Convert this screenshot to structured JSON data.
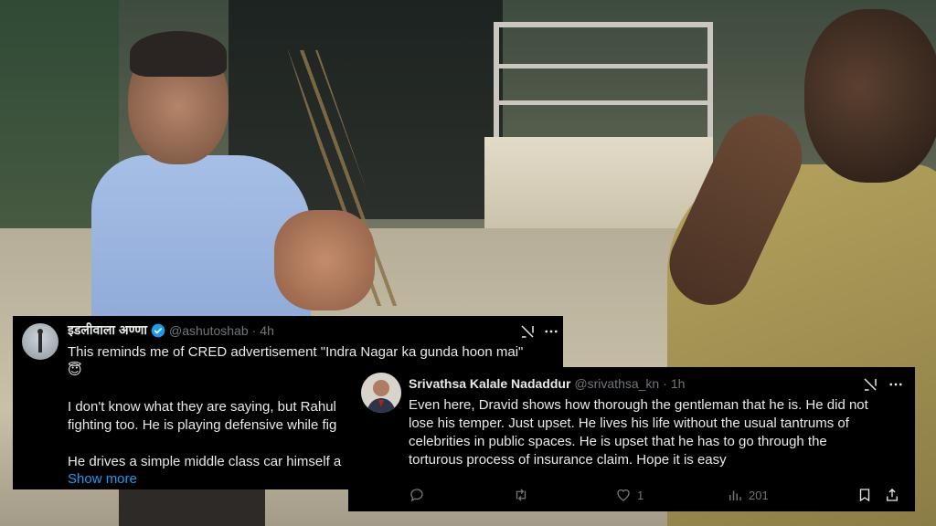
{
  "tweet_1": {
    "name": "इडलीवाला अण्णा",
    "handle": "@ashutoshab",
    "dot": "·",
    "time": "4h",
    "paragraphs": [
      "This reminds me of CRED advertisement \"Indra Nagar ka gunda hoon mai\"",
      "😇",
      "I don't know what they are saying, but Rahul",
      "fighting too.  He is playing defensive while fig",
      "He drives a simple middle class car himself a"
    ],
    "show_more": "Show more"
  },
  "tweet_2": {
    "name": "Srivathsa Kalale Nadaddur",
    "handle": "@srivathsa_kn",
    "dot": "·",
    "time": "1h",
    "lines": [
      "Even here, Dravid shows how thorough the gentleman that he is.  He did not",
      "lose his temper. Just upset. He lives his life without the usual tantrums of",
      "celebrities in public spaces. He is upset that he has to go through the",
      "torturous process of insurance claim. Hope it is easy"
    ],
    "likes": "1",
    "views": "201"
  },
  "colors": {
    "card_bg": "#000000",
    "text": "#e7e9ea",
    "muted": "#71767b",
    "link": "#1d9bf0",
    "verified": "#1d9bf0"
  },
  "icons": [
    "grok-icon",
    "more-icon",
    "verified-badge-icon",
    "reply-icon",
    "retweet-icon",
    "like-icon",
    "views-icon",
    "bookmark-icon",
    "share-icon"
  ]
}
